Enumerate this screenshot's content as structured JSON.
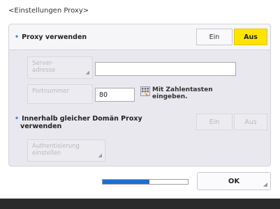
{
  "title": "<Einstellungen Proxy>",
  "proxy": {
    "label": "Proxy verwenden",
    "on_label": "Ein",
    "off_label": "Aus",
    "selected": "Aus"
  },
  "server": {
    "button_label_line1": "Server-",
    "button_label_line2": "adresse",
    "value": ""
  },
  "port": {
    "button_label": "Portnummer",
    "value": "80",
    "hint_line1": "Mit Zahlentasten",
    "hint_line2": "eingeben."
  },
  "same_domain": {
    "label_line1": "Innerhalb gleicher Domän Proxy",
    "label_line2": "verwenden",
    "on_label": "Ein",
    "off_label": "Aus"
  },
  "auth": {
    "label_line1": "Authentisierung",
    "label_line2": "einstellen"
  },
  "progress": {
    "fraction": 0.55
  },
  "ok_label": "OK",
  "colors": {
    "accent_selected": "#ffe400",
    "bullet": "#2a90e8",
    "progress": "#1e6fd0"
  }
}
